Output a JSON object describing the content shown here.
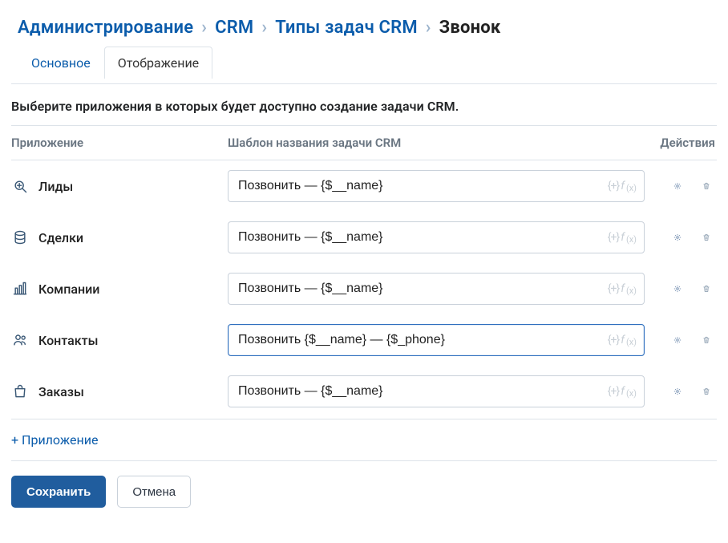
{
  "breadcrumb": {
    "admin": "Администрирование",
    "crm": "CRM",
    "types": "Типы задач CRM",
    "current": "Звонок"
  },
  "tabs": {
    "main": "Основное",
    "display": "Отображение"
  },
  "lead": "Выберите приложения в которых будет доступно создание задачи CRM.",
  "columns": {
    "app": "Приложение",
    "template": "Шаблон названия задачи CRM",
    "actions": "Действия"
  },
  "rows": [
    {
      "icon": "leads",
      "label": "Лиды",
      "value": "Позвонить — {$__name}",
      "focused": false
    },
    {
      "icon": "deals",
      "label": "Сделки",
      "value": "Позвонить — {$__name}",
      "focused": false
    },
    {
      "icon": "companies",
      "label": "Компании",
      "value": "Позвонить — {$__name}",
      "focused": false
    },
    {
      "icon": "contacts",
      "label": "Контакты",
      "value": "Позвонить {$__name} — {$_phone}",
      "focused": true
    },
    {
      "icon": "orders",
      "label": "Заказы",
      "value": "Позвонить — {$__name}",
      "focused": false
    }
  ],
  "fx_hint": "{+}f(x)",
  "add_label": "+ Приложение",
  "buttons": {
    "save": "Сохранить",
    "cancel": "Отмена"
  }
}
